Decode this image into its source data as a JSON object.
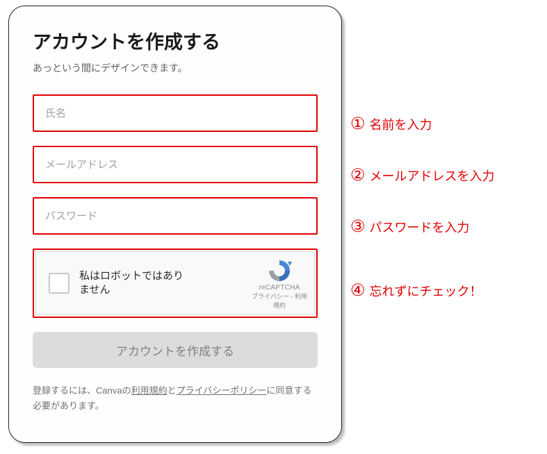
{
  "title": "アカウントを作成する",
  "subtitle": "あっという間にデザインできます。",
  "fields": {
    "name_placeholder": "氏名",
    "email_placeholder": "メールアドレス",
    "password_placeholder": "パスワード"
  },
  "captcha": {
    "label": "私はロボットではありません",
    "brand": "reCAPTCHA",
    "links": "プライバシー - 利用規約"
  },
  "submit_label": "アカウントを作成する",
  "legal": {
    "pre": "登録するには、Canvaの",
    "terms": "利用規約",
    "mid": "と",
    "privacy": "プライバシーポリシー",
    "post": "に同意する必要があります。"
  },
  "annotations": {
    "n1": "①",
    "t1": "名前を入力",
    "n2": "②",
    "t2": "メールアドレスを入力",
    "n3": "③",
    "t3": "パスワードを入力",
    "n4": "④",
    "t4": "忘れずにチェック！"
  }
}
